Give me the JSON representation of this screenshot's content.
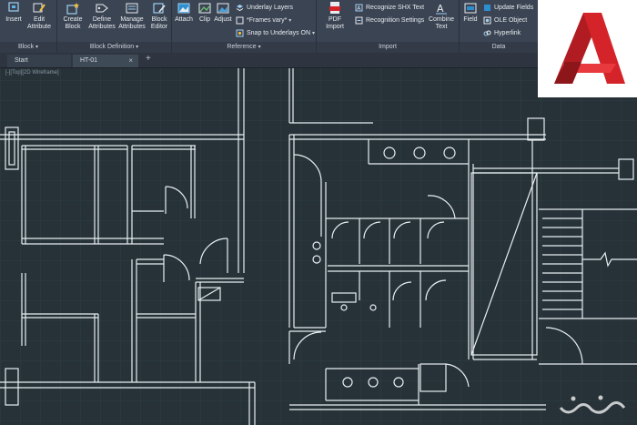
{
  "ribbon": {
    "block_panel": {
      "title": "Block",
      "insert": "Insert",
      "edit_attribute_1": "Edit",
      "edit_attribute_2": "Attribute"
    },
    "block_definition_panel": {
      "title": "Block Definition",
      "create_block_1": "Create",
      "create_block_2": "Block",
      "define_attributes_1": "Define",
      "define_attributes_2": "Attributes",
      "manage_attributes_1": "Manage",
      "manage_attributes_2": "Attributes",
      "block_editor_1": "Block",
      "block_editor_2": "Editor"
    },
    "reference_panel": {
      "title": "Reference",
      "attach": "Attach",
      "clip": "Clip",
      "adjust": "Adjust",
      "underlay_layers": "Underlay Layers",
      "frames_vary": "*Frames vary*",
      "snap_to_underlays": "Snap to Underlays ON"
    },
    "import_panel": {
      "title": "Import",
      "pdf_import_1": "PDF",
      "pdf_import_2": "Import",
      "recognize_shx": "Recognize SHX Text",
      "recognition_settings": "Recognition Settings",
      "combine_text_1": "Combine",
      "combine_text_2": "Text"
    },
    "data_panel": {
      "title": "Data",
      "field": "Field",
      "update_fields": "Update Fields",
      "ole_object": "OLE Object",
      "hyperlink": "Hyperlink"
    }
  },
  "tabs": {
    "start": "Start",
    "active": "HT-01",
    "close": "×",
    "add": "+"
  },
  "viewport_label": "[-][Top][2D Wireframe]",
  "colors": {
    "canvas": "#263238",
    "grid": "#2f3d45",
    "lines": "#e8eef2",
    "ribbon": "#3b4453",
    "logo_red": "#d4242a"
  }
}
